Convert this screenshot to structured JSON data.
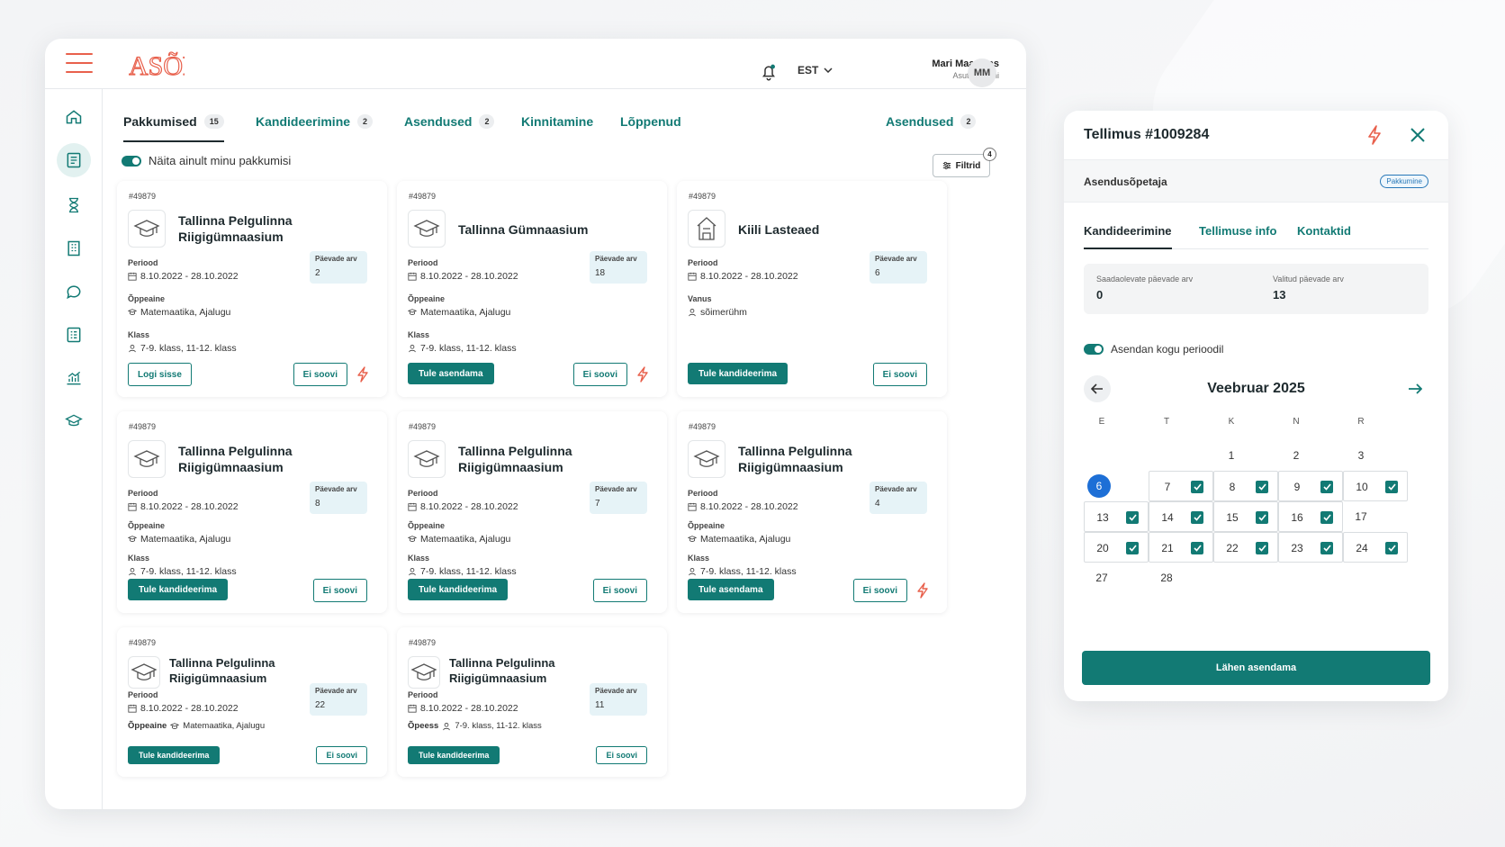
{
  "app": {
    "logo_text": "ASÕP",
    "language": "EST",
    "user_name": "Mari Maasikas",
    "user_org": "Asutuse nimi",
    "avatar_initials": "MM"
  },
  "tabs": [
    {
      "label": "Pakkumised",
      "count": "15"
    },
    {
      "label": "Kandideerimine",
      "count": "2"
    },
    {
      "label": "Asendused",
      "count": "2"
    },
    {
      "label": "Kinnitamine",
      "count": ""
    },
    {
      "label": "Lõppenud",
      "count": ""
    },
    {
      "label": "Asendused",
      "count": "2"
    }
  ],
  "toolbar": {
    "toggle_label": "Näita ainult minu pakkumisi",
    "filter_label": "Filtrid",
    "filter_count": "4"
  },
  "labels": {
    "period": "Periood",
    "subject": "Õppeaine",
    "class": "Klass",
    "age": "Vanus",
    "days": "Päevade arv",
    "subject_alt": "Õpeess"
  },
  "cards": [
    {
      "id": "#49879",
      "school": "Tallinna Pelgulinna Riigigümnaasium",
      "period": "8.10.2022 - 28.10.2022",
      "days": "2",
      "subject": "Matemaatika, Ajalugu",
      "class": "7-9. klass, 11-12. klass",
      "primary": "Logi sisse",
      "secondary": "Ei soovi",
      "bolt": true,
      "icon": "graduation-cap-icon"
    },
    {
      "id": "#49879",
      "school": "Tallinna Gümnaasium",
      "period": "8.10.2022 - 28.10.2022",
      "days": "18",
      "subject": "Matemaatika, Ajalugu",
      "class": "7-9. klass, 11-12. klass",
      "primary": "Tule asendama",
      "secondary": "Ei soovi",
      "bolt": true,
      "icon": "graduation-cap-icon"
    },
    {
      "id": "#49879",
      "school": "Kiili Lasteaed",
      "period": "8.10.2022 - 28.10.2022",
      "days": "6",
      "age": "sõimerühm",
      "primary": "Tule kandideerima",
      "secondary": "Ei soovi",
      "bolt": false,
      "icon": "kindergarten-icon"
    },
    {
      "id": "#49879",
      "school": "Tallinna Pelgulinna Riigigümnaasium",
      "period": "8.10.2022 - 28.10.2022",
      "days": "8",
      "subject": "Matemaatika, Ajalugu",
      "class": "7-9. klass, 11-12. klass",
      "primary": "Tule kandideerima",
      "secondary": "Ei soovi",
      "bolt": false,
      "icon": "graduation-cap-icon"
    },
    {
      "id": "#49879",
      "school": "Tallinna Pelgulinna Riigigümnaasium",
      "period": "8.10.2022 - 28.10.2022",
      "days": "7",
      "subject": "Matemaatika, Ajalugu",
      "class": "7-9. klass, 11-12. klass",
      "primary": "Tule kandideerima",
      "secondary": "Ei soovi",
      "bolt": false,
      "icon": "graduation-cap-icon"
    },
    {
      "id": "#49879",
      "school": "Tallinna Pelgulinna Riigigümnaasium",
      "period": "8.10.2022 - 28.10.2022",
      "days": "4",
      "subject": "Matemaatika, Ajalugu",
      "class": "7-9. klass, 11-12. klass",
      "primary": "Tule asendama",
      "secondary": "Ei soovi",
      "bolt": true,
      "icon": "graduation-cap-icon"
    },
    {
      "id": "#49879",
      "school": "Tallinna Pelgulinna Riigigümnaasium",
      "period": "8.10.2022 - 28.10.2022",
      "days": "22",
      "subject": "Matemaatika, Ajalugu",
      "primary": "Tule kandideerima",
      "secondary": "Ei soovi",
      "bolt": false,
      "icon": "graduation-cap-icon"
    },
    {
      "id": "#49879",
      "school": "Tallinna Pelgulinna Riigigümnaasium",
      "period": "8.10.2022 - 28.10.2022",
      "days": "11",
      "class": "7-9. klass, 11-12. klass",
      "primary": "Tule kandideerima",
      "secondary": "Ei soovi",
      "bolt": false,
      "icon": "graduation-cap-icon"
    }
  ],
  "panel": {
    "title": "Tellimus #1009284",
    "role": "Asendusõpetaja",
    "status_pill": "Pakkumine",
    "tabs": [
      "Kandideerimine",
      "Tellimuse info",
      "Kontaktid"
    ],
    "available_days_label": "Saadaolevate päevade arv",
    "available_days": "0",
    "selected_days_label": "Valitud päevade arv",
    "selected_days": "13",
    "toggle_label": "Asendan kogu perioodil",
    "month": "Veebruar 2025",
    "weekdays": [
      "E",
      "T",
      "K",
      "N",
      "R"
    ],
    "cta": "Lähen asendama",
    "calendar_rows": [
      [
        {
          "d": ""
        },
        {
          "d": ""
        },
        {
          "d": "1"
        },
        {
          "d": "2"
        },
        {
          "d": "3"
        }
      ],
      [
        {
          "d": "6",
          "today": true
        },
        {
          "d": "7",
          "c": true
        },
        {
          "d": "8",
          "c": true
        },
        {
          "d": "9",
          "c": true
        },
        {
          "d": "10",
          "c": true
        }
      ],
      [
        {
          "d": "13",
          "c": true
        },
        {
          "d": "14",
          "c": true
        },
        {
          "d": "15",
          "c": true
        },
        {
          "d": "16",
          "c": true
        },
        {
          "d": "17"
        }
      ],
      [
        {
          "d": "20",
          "c": true
        },
        {
          "d": "21",
          "c": true
        },
        {
          "d": "22",
          "c": true
        },
        {
          "d": "23",
          "c": true
        },
        {
          "d": "24",
          "c": true
        }
      ],
      [
        {
          "d": "27"
        },
        {
          "d": "28"
        },
        {
          "d": ""
        },
        {
          "d": ""
        },
        {
          "d": ""
        }
      ]
    ]
  },
  "colors": {
    "accent": "#127a74",
    "brand": "#e8604c",
    "today": "#1d6fd6"
  }
}
